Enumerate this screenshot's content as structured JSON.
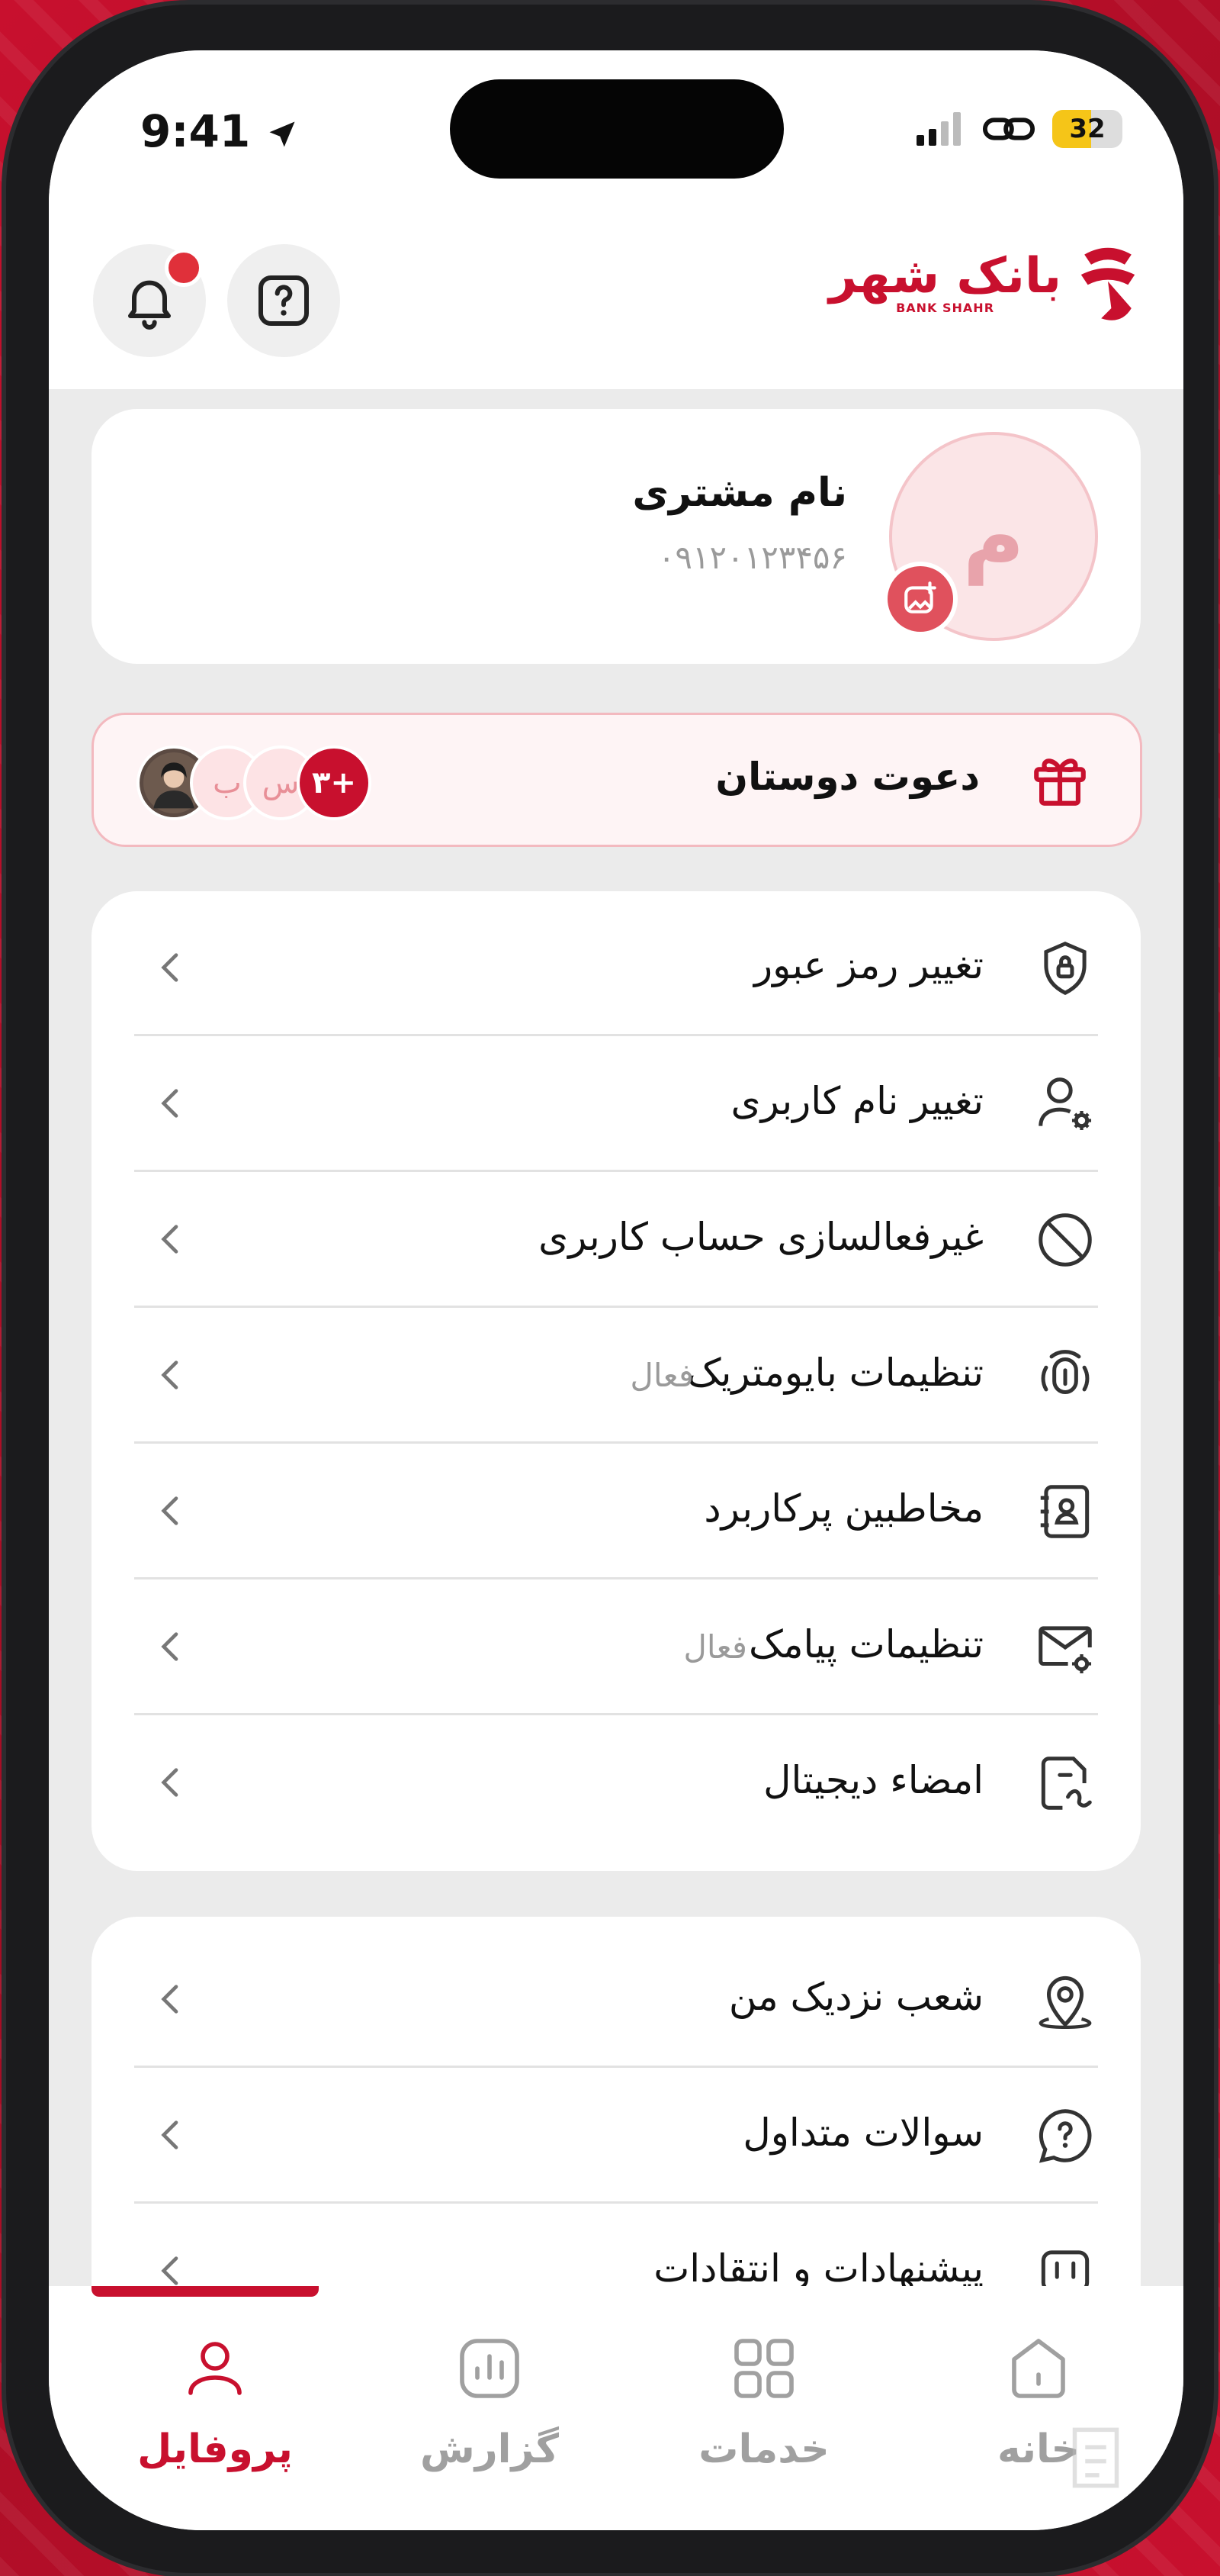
{
  "status_bar": {
    "time": "9:41",
    "battery": "32"
  },
  "brand": {
    "logo_text": "بانک شهر",
    "logo_sub": "BANK SHAHR",
    "accent": "#c8102e"
  },
  "profile": {
    "avatar_letter": "م",
    "name": "نام مشتری",
    "phone": "۰۹۱۲۰۱۲۳۴۵۶"
  },
  "invite": {
    "label": "دعوت دوستان",
    "friends": [
      "ب",
      "س"
    ],
    "extra_count": "+۳"
  },
  "security_menu": [
    {
      "label": "تغییر رمز عبور",
      "icon": "shield-lock-icon",
      "status": ""
    },
    {
      "label": "تغییر نام کاربری",
      "icon": "user-gear-icon",
      "status": ""
    },
    {
      "label": "غیرفعالسازی حساب کاربری",
      "icon": "block-icon",
      "status": ""
    },
    {
      "label": "تنظیمات بایومتریک",
      "icon": "fingerprint-icon",
      "status": "فعال"
    },
    {
      "label": "مخاطبین پرکاربرد",
      "icon": "contacts-icon",
      "status": ""
    },
    {
      "label": "تنظیمات پیامک",
      "icon": "mail-gear-icon",
      "status": "فعال"
    },
    {
      "label": "امضاء دیجیتال",
      "icon": "signature-icon",
      "status": ""
    }
  ],
  "support_menu": [
    {
      "label": "شعب نزدیک من",
      "icon": "location-pin-icon"
    },
    {
      "label": "سوالات متداول",
      "icon": "question-bubble-icon"
    },
    {
      "label": "پیشنهادات و انتقادات",
      "icon": "feedback-icon"
    }
  ],
  "bottom_nav": [
    {
      "label": "خانه",
      "icon": "home-icon",
      "active": false
    },
    {
      "label": "خدمات",
      "icon": "grid-icon",
      "active": false
    },
    {
      "label": "گزارش",
      "icon": "chart-icon",
      "active": false
    },
    {
      "label": "پروفایل",
      "icon": "user-icon",
      "active": true
    }
  ]
}
